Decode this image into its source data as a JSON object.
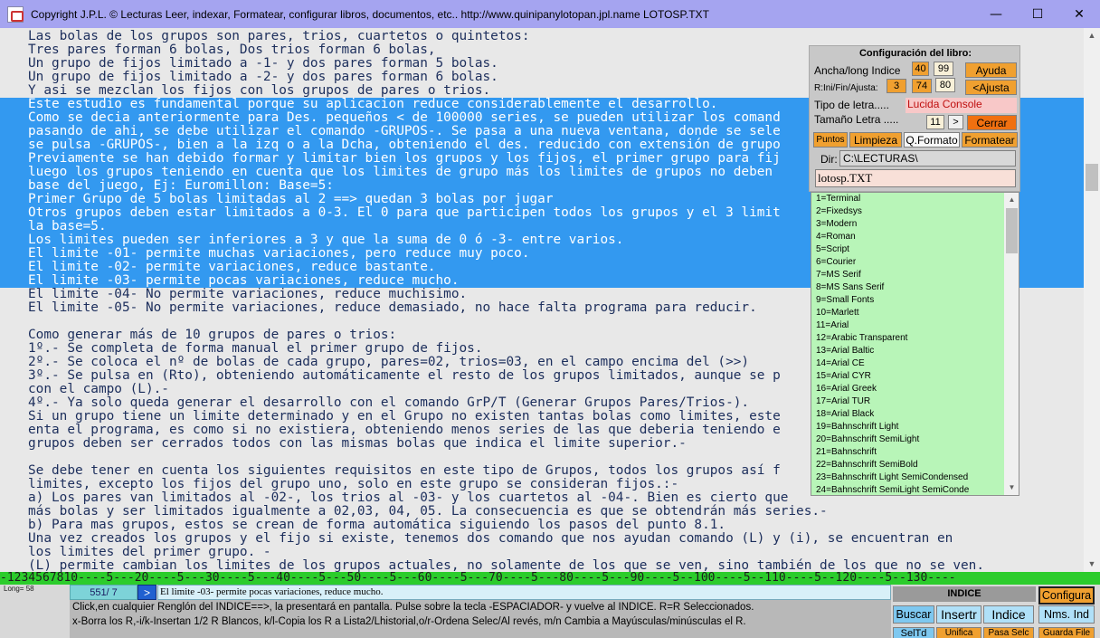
{
  "window": {
    "title": "Copyright  J.P.L. ©     Lecturas      Leer, indexar, Formatear, configurar libros, documentos, etc..  http://www.quinipanylotopan.jpl.name    LOTOSP.TXT",
    "minimize": "—",
    "maximize": "☐",
    "close": "✕"
  },
  "text_lines": [
    {
      "text": "Las bolas de los grupos son pares, trios, cuartetos o quintetos:",
      "sel": false
    },
    {
      "text": "Tres pares forman 6 bolas, Dos trios forman 6 bolas,",
      "sel": false
    },
    {
      "text": "Un grupo de fijos limitado a -1- y dos pares forman 5 bolas.",
      "sel": false
    },
    {
      "text": "Un grupo de fijos limitado a -2- y dos pares forman 6 bolas.",
      "sel": false
    },
    {
      "text": "Y asi se mezclan los fijos con los grupos de pares o trios.",
      "sel": false
    },
    {
      "text": "Este estudio es fundamental porque su aplicacion reduce considerablemente el desarrollo.",
      "sel": true
    },
    {
      "text": "Como se decia anteriormente para Des. pequeños < de 100000 series, se pueden utilizar los comand",
      "sel": true
    },
    {
      "text": "pasando de ahi, se debe utilizar el comando -GRUPOS-. Se pasa a una nueva ventana, donde se sele",
      "sel": true
    },
    {
      "text": "se pulsa -GRUPOS-, bien a la izq o a la Dcha, obteniendo el des. reducido con extensión de grupo",
      "sel": true
    },
    {
      "text": "Previamente se han debido formar y limitar bien los grupos y los fijos, el primer grupo para fij        ado",
      "sel": true
    },
    {
      "text": "luego los grupos teniendo en cuenta que los limites de grupo más los limites de grupos no deben",
      "sel": true
    },
    {
      "text": "base del juego, Ej: Euromillon: Base=5:",
      "sel": true
    },
    {
      "text": "Primer Grupo de 5 bolas limitadas al 2 ==> quedan 3 bolas por jugar",
      "sel": true
    },
    {
      "text": "Otros grupos deben estar limitados a 0-3. El 0 para que participen todos los grupos y el 3 limit",
      "sel": true
    },
    {
      "text": "la base=5.",
      "sel": true
    },
    {
      "text": "Los limites pueden ser inferiores a 3 y que la suma de 0 ó -3- entre varios.",
      "sel": true
    },
    {
      "text": "El limite -01- permite muchas variaciones, pero reduce muy poco.",
      "sel": true
    },
    {
      "text": "El limite -02- permite variaciones, reduce bastante.",
      "sel": true
    },
    {
      "text": "El limite -03- permite pocas variaciones, reduce mucho.",
      "sel": true
    },
    {
      "text": "El limite -04- No permite variaciones, reduce muchisimo.",
      "sel": false
    },
    {
      "text": "El limite -05- No permite variaciones, reduce demasiado, no hace falta programa para reducir.",
      "sel": false
    },
    {
      "text": "",
      "sel": false
    },
    {
      "text": "Como generar más de 10 grupos de pares o trios:",
      "sel": false
    },
    {
      "text": "1º.- Se completa de forma manual el primer grupo de fijos.",
      "sel": false
    },
    {
      "text": "2º.- Se coloca el nº de bolas de cada grupo, pares=02, trios=03, en el campo encima del (>>)",
      "sel": false
    },
    {
      "text": "3º.- Se pulsa en (Rto), obteniendo automáticamente el resto de los grupos limitados, aunque se p",
      "sel": false
    },
    {
      "text": "con el campo (L).-",
      "sel": false
    },
    {
      "text": "4º.- Ya solo queda generar el desarrollo con el comando GrP/T (Generar Grupos Pares/Trios-).",
      "sel": false
    },
    {
      "text": "Si un grupo tiene un limite determinado y en el Grupo no existen tantas bolas como limites, este",
      "sel": false
    },
    {
      "text": "enta el programa, es como si no existiera, obteniendo menos series de las que deberia teniendo e        s",
      "sel": false
    },
    {
      "text": "grupos deben ser cerrados todos con las mismas bolas que indica el limite superior.-",
      "sel": false
    },
    {
      "text": "",
      "sel": false
    },
    {
      "text": "Se debe tener en cuenta los siguientes requisitos en este tipo de Grupos, todos los grupos así f",
      "sel": false
    },
    {
      "text": "limites, excepto los fijos del grupo uno, solo en este grupo se consideran fijos.:-",
      "sel": false
    },
    {
      "text": "a) Los pares van limitados al -02-, los trios al -03- y los cuartetos al -04-. Bien es cierto que",
      "sel": false
    },
    {
      "text": "más bolas y ser limitados igualmente a 02,03, 04, 05. La consecuencia es que se obtendrán más series.-",
      "sel": false
    },
    {
      "text": "b) Para mas grupos, estos se crean de forma automática siguiendo los pasos del punto 8.1.",
      "sel": false
    },
    {
      "text": "Una vez creados los grupos y el fijo si existe, tenemos dos comando que nos ayudan comando (L) y (i), se encuentran en",
      "sel": false
    },
    {
      "text": "los limites del primer grupo. -",
      "sel": false
    },
    {
      "text": "(L) permite cambian los limites de los grupos actuales, no solamente de los que se ven, sino también de los que no se ven.",
      "sel": false
    }
  ],
  "ruler": "-1234567810----5---20----5---30----5---40----5---50----5---60----5---70----5---80----5---90----5--100----5--110----5--120----5--130----",
  "bottom": {
    "long_label": "Long= 58",
    "counter": "551/ 7",
    "go_label": ">",
    "current_line": "El limite -03- permite pocas variaciones, reduce mucho.",
    "help_line1": "Click,en cualquier Renglón del INDICE==>, la presentará en pantalla. Pulse sobre la tecla -ESPACIADOR- y vuelve al INDICE.  R=R Seleccionados.",
    "help_line2": "x-Borra los R,-i/k-Insertan 1/2 R Blancos, k/l-Copia los R a Lista2/Lhistorial,o/r-Ordena Selec/Al revés, m/n Cambia a Mayúsculas/minúsculas el R.",
    "indice_header": "INDICE",
    "configura": "Configura",
    "buscar": "Buscar",
    "insertr": "Insertr",
    "indice": "Indice",
    "nms_ind": "Nms. Ind",
    "seltd": "SelTd",
    "unifica": "Unifica",
    "pasa_selc": "Pasa Selc",
    "guarda_file": "Guarda File"
  },
  "config": {
    "title": "Configuración del libro:",
    "ancha_label": "Ancha/long Indice",
    "ancha_val1": "40",
    "ancha_val2": "99",
    "ayuda": "Ayuda",
    "rini_label": "R:Ini/Fin/Ajusta:",
    "rini_val1": "3",
    "rini_val2": "74",
    "rini_val3": "80",
    "ajusta": "<Ajusta",
    "tipo_label": "Tipo de letra.....",
    "font_name": "Lucida Console",
    "tamano_label": "Tamaño Letra .....",
    "tamano_val": "11",
    "tamano_btn": ">",
    "cerrar": "Cerrar",
    "puntos": "Puntos",
    "limpieza": "Limpieza",
    "qformato": "Q.Formato",
    "formatear": "Formatear",
    "dir_label": "Dir:",
    "dir_val": "C:\\LECTURAS\\",
    "file_val": "lotosp.TXT"
  },
  "fonts": [
    "1=Terminal",
    "2=Fixedsys",
    "3=Modern",
    "4=Roman",
    "5=Script",
    "6=Courier",
    "7=MS Serif",
    "8=MS Sans Serif",
    "9=Small Fonts",
    "10=Marlett",
    "11=Arial",
    "12=Arabic Transparent",
    "13=Arial Baltic",
    "14=Arial CE",
    "15=Arial CYR",
    "16=Arial Greek",
    "17=Arial TUR",
    "18=Arial Black",
    "19=Bahnschrift Light",
    "20=Bahnschrift SemiLight",
    "21=Bahnschrift",
    "22=Bahnschrift SemiBold",
    "23=Bahnschrift Light SemiCondensed",
    "24=Bahnschrift SemiLight SemiConde"
  ],
  "colors": {
    "titlebar": "#a5a4f0",
    "selection": "#3399f0",
    "text": "#1c2e5c",
    "ruler": "#2ccc2c",
    "fontlist": "#b8f5b8",
    "orange": "#f0a030"
  }
}
